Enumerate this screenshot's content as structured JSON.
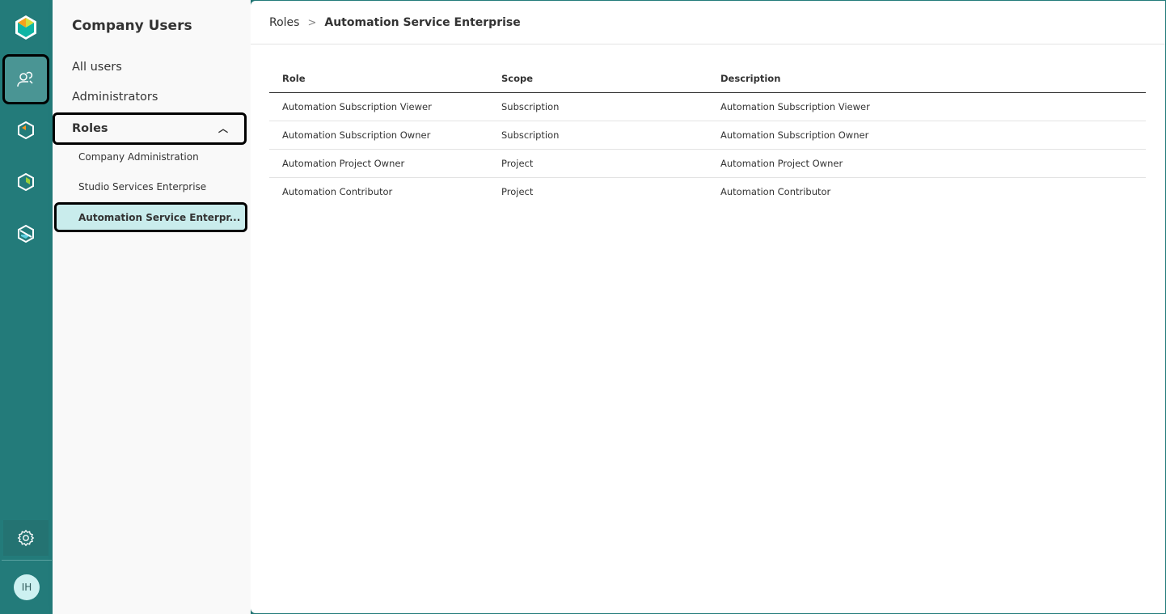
{
  "rail": {
    "items": [
      "logo-icon",
      "users-icon",
      "product-a-icon",
      "product-b-icon",
      "product-c-icon",
      "settings-icon"
    ],
    "avatar": "IH",
    "color": "#237b7a"
  },
  "sidebar": {
    "title": "Company Users",
    "items": [
      {
        "label": "All users"
      },
      {
        "label": "Administrators"
      },
      {
        "label": "Roles"
      }
    ],
    "subitems": [
      {
        "label": "Company Administration"
      },
      {
        "label": "Studio Services Enterprise"
      },
      {
        "label": "Automation Service Enterpr..."
      }
    ]
  },
  "breadcrumb": {
    "parent": "Roles",
    "current": "Automation Service Enterprise"
  },
  "table": {
    "headers": [
      "Role",
      "Scope",
      "Description"
    ],
    "rows": [
      [
        "Automation Subscription Viewer",
        "Subscription",
        "Automation Subscription Viewer"
      ],
      [
        "Automation Subscription Owner",
        "Subscription",
        "Automation Subscription Owner"
      ],
      [
        "Automation Project Owner",
        "Project",
        "Automation Project Owner"
      ],
      [
        "Automation Contributor",
        "Project",
        "Automation Contributor"
      ]
    ]
  }
}
